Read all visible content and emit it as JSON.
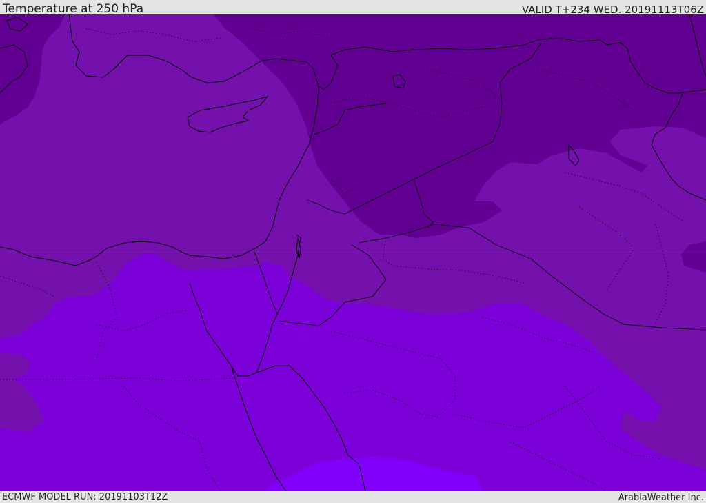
{
  "header": {
    "title": "Temperature at 250 hPa",
    "valid_time": "VALID T+234 WED. 20191113T06Z"
  },
  "footer": {
    "model_run": "ECMWF MODEL RUN: 20191103T12Z",
    "credit": "ArabiaWeather Inc."
  },
  "colors": {
    "band_darkest": "#620094",
    "band_dark": "#7410ac",
    "band_mid": "#7c00d8",
    "band_bright": "#8000fc",
    "border_line": "#000000"
  }
}
